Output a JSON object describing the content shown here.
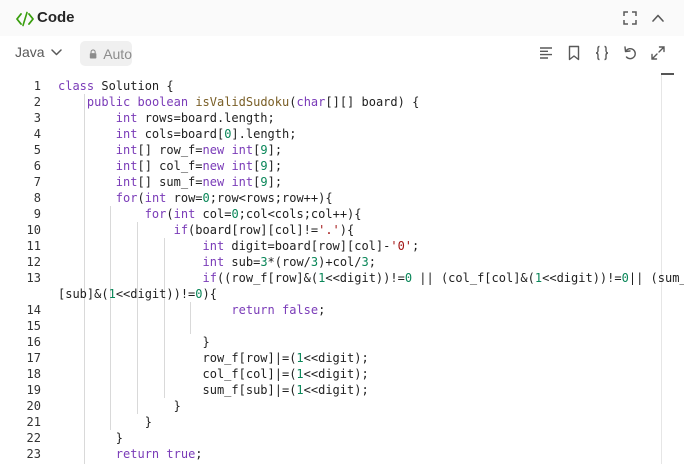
{
  "header": {
    "title": "Code",
    "code_icon": "code-brackets-icon",
    "fullscreen_icon": "fullscreen-icon",
    "collapse_icon": "chevron-up-icon"
  },
  "toolbar": {
    "language": "Java",
    "mode_label": "Auto",
    "icons": [
      "format-lines-icon",
      "bookmark-icon",
      "braces-icon",
      "undo-icon",
      "expand-icon"
    ]
  },
  "colors": {
    "keyword": "#7a3bb8",
    "function": "#795e26",
    "number": "#098658",
    "string": "#a31515",
    "accent_green": "#389e0d"
  },
  "editor": {
    "lines": [
      {
        "n": "1",
        "tokens": [
          [
            "kw",
            "class"
          ],
          [
            "pl",
            " Solution {"
          ]
        ]
      },
      {
        "n": "2",
        "tokens": [
          [
            "pl",
            "    "
          ],
          [
            "kw",
            "public"
          ],
          [
            "pl",
            " "
          ],
          [
            "ty",
            "boolean"
          ],
          [
            "pl",
            " "
          ],
          [
            "fn",
            "isValidSudoku"
          ],
          [
            "pl",
            "("
          ],
          [
            "ty",
            "char"
          ],
          [
            "pl",
            "[][] board) {"
          ]
        ]
      },
      {
        "n": "3",
        "tokens": [
          [
            "pl",
            "        "
          ],
          [
            "ty",
            "int"
          ],
          [
            "pl",
            " rows=board.length;"
          ]
        ]
      },
      {
        "n": "4",
        "tokens": [
          [
            "pl",
            "        "
          ],
          [
            "ty",
            "int"
          ],
          [
            "pl",
            " cols=board["
          ],
          [
            "nm",
            "0"
          ],
          [
            "pl",
            "].length;"
          ]
        ]
      },
      {
        "n": "5",
        "tokens": [
          [
            "pl",
            "        "
          ],
          [
            "ty",
            "int"
          ],
          [
            "pl",
            "[] row_f="
          ],
          [
            "kw",
            "new"
          ],
          [
            "pl",
            " "
          ],
          [
            "ty",
            "int"
          ],
          [
            "pl",
            "["
          ],
          [
            "nm",
            "9"
          ],
          [
            "pl",
            "];"
          ]
        ]
      },
      {
        "n": "6",
        "tokens": [
          [
            "pl",
            "        "
          ],
          [
            "ty",
            "int"
          ],
          [
            "pl",
            "[] col_f="
          ],
          [
            "kw",
            "new"
          ],
          [
            "pl",
            " "
          ],
          [
            "ty",
            "int"
          ],
          [
            "pl",
            "["
          ],
          [
            "nm",
            "9"
          ],
          [
            "pl",
            "];"
          ]
        ]
      },
      {
        "n": "7",
        "tokens": [
          [
            "pl",
            "        "
          ],
          [
            "ty",
            "int"
          ],
          [
            "pl",
            "[] sum_f="
          ],
          [
            "kw",
            "new"
          ],
          [
            "pl",
            " "
          ],
          [
            "ty",
            "int"
          ],
          [
            "pl",
            "["
          ],
          [
            "nm",
            "9"
          ],
          [
            "pl",
            "];"
          ]
        ]
      },
      {
        "n": "8",
        "tokens": [
          [
            "pl",
            "        "
          ],
          [
            "kw",
            "for"
          ],
          [
            "pl",
            "("
          ],
          [
            "ty",
            "int"
          ],
          [
            "pl",
            " row="
          ],
          [
            "nm",
            "0"
          ],
          [
            "pl",
            ";row<rows;row++){"
          ]
        ]
      },
      {
        "n": "9",
        "tokens": [
          [
            "pl",
            "            "
          ],
          [
            "kw",
            "for"
          ],
          [
            "pl",
            "("
          ],
          [
            "ty",
            "int"
          ],
          [
            "pl",
            " col="
          ],
          [
            "nm",
            "0"
          ],
          [
            "pl",
            ";col<cols;col++){"
          ]
        ]
      },
      {
        "n": "10",
        "tokens": [
          [
            "pl",
            "                "
          ],
          [
            "kw",
            "if"
          ],
          [
            "pl",
            "(board[row][col]!="
          ],
          [
            "st",
            "'.'"
          ],
          [
            "pl",
            "){"
          ]
        ]
      },
      {
        "n": "11",
        "tokens": [
          [
            "pl",
            "                    "
          ],
          [
            "ty",
            "int"
          ],
          [
            "pl",
            " digit=board[row][col]-"
          ],
          [
            "st",
            "'0'"
          ],
          [
            "pl",
            ";"
          ]
        ]
      },
      {
        "n": "12",
        "tokens": [
          [
            "pl",
            "                    "
          ],
          [
            "ty",
            "int"
          ],
          [
            "pl",
            " sub="
          ],
          [
            "nm",
            "3"
          ],
          [
            "pl",
            "*(row/"
          ],
          [
            "nm",
            "3"
          ],
          [
            "pl",
            ")+col/"
          ],
          [
            "nm",
            "3"
          ],
          [
            "pl",
            ";"
          ]
        ]
      },
      {
        "n": "13",
        "tokens": [
          [
            "pl",
            "                    "
          ],
          [
            "kw",
            "if"
          ],
          [
            "pl",
            "((row_f[row]&("
          ],
          [
            "nm",
            "1"
          ],
          [
            "pl",
            "<<digit))!="
          ],
          [
            "nm",
            "0"
          ],
          [
            "pl",
            " || (col_f[col]&("
          ],
          [
            "nm",
            "1"
          ],
          [
            "pl",
            "<<digit))!="
          ],
          [
            "nm",
            "0"
          ],
          [
            "pl",
            "|| (sum_f"
          ]
        ]
      },
      {
        "n": "",
        "tokens": [
          [
            "pl",
            "[sub]&("
          ],
          [
            "nm",
            "1"
          ],
          [
            "pl",
            "<<digit))!="
          ],
          [
            "nm",
            "0"
          ],
          [
            "pl",
            "){"
          ]
        ]
      },
      {
        "n": "14",
        "tokens": [
          [
            "pl",
            "                        "
          ],
          [
            "kw",
            "return"
          ],
          [
            "pl",
            " "
          ],
          [
            "kw",
            "false"
          ],
          [
            "pl",
            ";"
          ]
        ]
      },
      {
        "n": "15",
        "tokens": []
      },
      {
        "n": "16",
        "tokens": [
          [
            "pl",
            "                    }"
          ]
        ]
      },
      {
        "n": "17",
        "tokens": [
          [
            "pl",
            "                    row_f[row]|=("
          ],
          [
            "nm",
            "1"
          ],
          [
            "pl",
            "<<digit);"
          ]
        ]
      },
      {
        "n": "18",
        "tokens": [
          [
            "pl",
            "                    col_f[col]|=("
          ],
          [
            "nm",
            "1"
          ],
          [
            "pl",
            "<<digit);"
          ]
        ]
      },
      {
        "n": "19",
        "tokens": [
          [
            "pl",
            "                    sum_f[sub]|=("
          ],
          [
            "nm",
            "1"
          ],
          [
            "pl",
            "<<digit);"
          ]
        ]
      },
      {
        "n": "20",
        "tokens": [
          [
            "pl",
            "                }"
          ]
        ]
      },
      {
        "n": "21",
        "tokens": [
          [
            "pl",
            "            }"
          ]
        ]
      },
      {
        "n": "22",
        "tokens": [
          [
            "pl",
            "        }"
          ]
        ]
      },
      {
        "n": "23",
        "tokens": [
          [
            "pl",
            "        "
          ],
          [
            "kw",
            "return"
          ],
          [
            "pl",
            " "
          ],
          [
            "kw",
            "true"
          ],
          [
            "pl",
            ";"
          ]
        ]
      }
    ]
  }
}
